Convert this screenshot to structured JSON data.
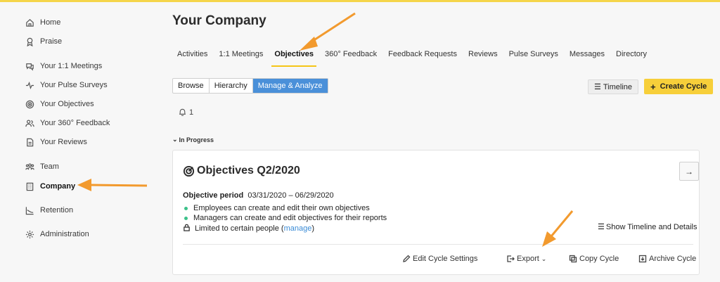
{
  "sidebar": {
    "items": [
      {
        "label": "Home",
        "icon": "home-icon"
      },
      {
        "label": "Praise",
        "icon": "award-icon"
      },
      {
        "label": "Your 1:1 Meetings",
        "icon": "chat-icon"
      },
      {
        "label": "Your Pulse Surveys",
        "icon": "pulse-icon"
      },
      {
        "label": "Your Objectives",
        "icon": "target-icon"
      },
      {
        "label": "Your 360° Feedback",
        "icon": "people-icon"
      },
      {
        "label": "Your Reviews",
        "icon": "document-icon"
      },
      {
        "label": "Team",
        "icon": "team-icon"
      },
      {
        "label": "Company",
        "icon": "building-icon"
      },
      {
        "label": "Retention",
        "icon": "chart-icon"
      },
      {
        "label": "Administration",
        "icon": "gear-icon"
      }
    ],
    "active": "Company"
  },
  "header": {
    "title": "Your Company"
  },
  "tabs": [
    "Activities",
    "1:1 Meetings",
    "Objectives",
    "360° Feedback",
    "Feedback Requests",
    "Reviews",
    "Pulse Surveys",
    "Messages",
    "Directory"
  ],
  "active_tab": "Objectives",
  "view_toggle": {
    "browse": "Browse",
    "hierarchy": "Hierarchy",
    "manage": "Manage & Analyze"
  },
  "toolbar": {
    "timeline_label": "Timeline",
    "create_cycle_label": "Create Cycle"
  },
  "notifications": {
    "count": "1"
  },
  "section": {
    "label": "In Progress"
  },
  "cycle": {
    "title": "Objectives Q2/2020",
    "period_label": "Objective period",
    "period_value": "03/31/2020 – 06/29/2020",
    "rule1": "Employees can create and edit their own objectives",
    "rule2": "Managers can create and edit objectives for their reports",
    "rule3_prefix": "Limited to certain people (",
    "rule3_link": "manage",
    "rule3_suffix": ")",
    "show_timeline_label": "Show Timeline and Details",
    "edit_label": "Edit Cycle Settings",
    "export_label": "Export",
    "copy_label": "Copy Cycle",
    "archive_label": "Archive Cycle"
  },
  "colors": {
    "accent": "#4a90d9",
    "brand_yellow": "#f7cf3a",
    "status_green": "#3cc18a",
    "annotation_orange": "#f29a2e"
  }
}
